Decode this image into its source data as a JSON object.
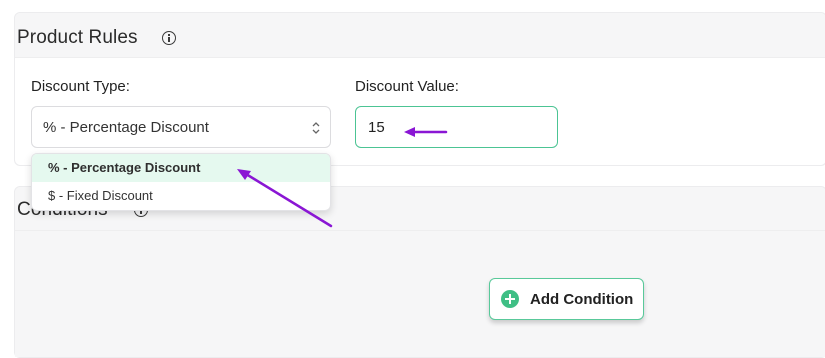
{
  "product_rules": {
    "title": "Product Rules",
    "discount_type": {
      "label": "Discount Type:",
      "selected": "% - Percentage Discount",
      "options": [
        "% - Percentage Discount",
        "$ - Fixed Discount"
      ]
    },
    "discount_value": {
      "label": "Discount Value:",
      "value": "15"
    }
  },
  "conditions": {
    "title": "Conditions",
    "add_button_label": "Add Condition"
  },
  "colors": {
    "accent": "#4cc494",
    "highlight_option": "#e5f9ef",
    "annotation_arrow": "#8a16d4"
  },
  "icons": [
    "info-icon",
    "chevron-updown-icon",
    "plus-circle-icon",
    "arrow-annotation"
  ]
}
